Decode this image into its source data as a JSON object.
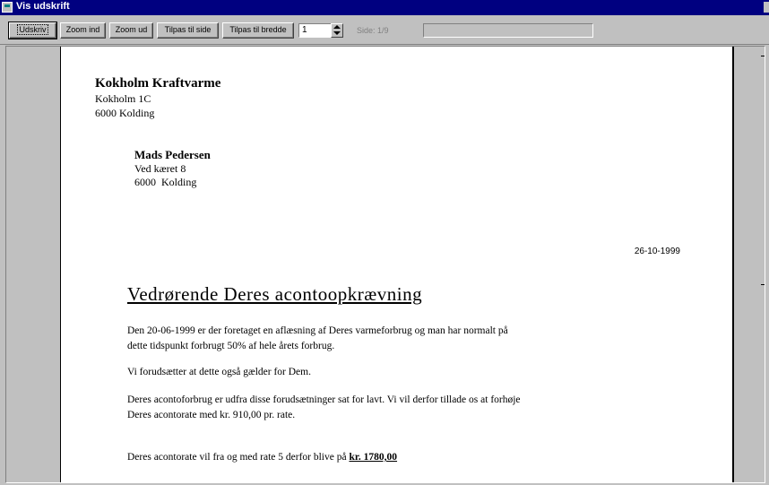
{
  "window": {
    "title": "Vis udskrift",
    "icon": "preview-window-icon"
  },
  "toolbar": {
    "print_label": "Udskriv",
    "zoom_in_label": "Zoom ind",
    "zoom_out_label": "Zoom ud",
    "fit_page_label": "Tilpas til side",
    "fit_width_label": "Tilpas til bredde",
    "page_value": "1",
    "page_status": "Side: 1/9",
    "status_text": ""
  },
  "letter": {
    "sender": {
      "name": "Kokholm Kraftvarme",
      "address": "Kokholm 1C",
      "city": "6000 Kolding"
    },
    "recipient": {
      "name": "Mads Pedersen",
      "address": "Ved kæret 8",
      "city": "6000  Kolding"
    },
    "date": "26-10-1999",
    "heading": "Vedrørende Deres acontoopkrævning",
    "paragraph1": {
      "line1": "Den 20-06-1999 er der foretaget en aflæsning af Deres varmeforbrug og man har normalt på",
      "line2": "dette tidspunkt forbrugt 50% af hele årets forbrug."
    },
    "paragraph2": "Vi forudsætter at dette også gælder for Dem.",
    "paragraph3": {
      "line1": "Deres acontoforbrug er udfra disse forudsætninger sat for lavt. Vi vil derfor tillade os at forhøje",
      "line2": "Deres acontorate med kr. 910,00 pr. rate."
    },
    "paragraph4": {
      "text": "Deres acontorate vil fra og med rate 5 derfor blive på ",
      "amount": "kr. 1780,00"
    }
  }
}
